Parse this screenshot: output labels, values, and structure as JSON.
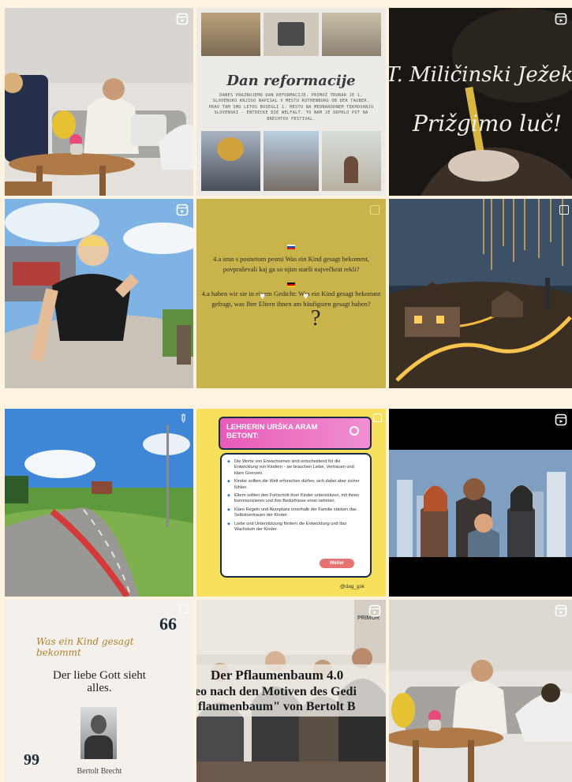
{
  "grid": {
    "posts": [
      {
        "type": "reel",
        "alt": "Two young people sitting on a sofa in a living room"
      },
      {
        "type": "carousel",
        "title": "Dan reformacije",
        "body": "DANES PRAZNUJEMO DAN REFORMACIJE. PRIMOŽ TRUBAR JE 1. SLOVENSKO KNJIGO NAPISAL V MESTU ROTHENBURG OB DER TAUBER. PRAV TAM SMO LETOS BOSEGLI 1. MESTO NA MEDNARODNEM TEKMOVANJU SLOVENSKI - ENTDECKE DIE WELFALT. TO NAM JE ODPRLO POT NA BRECHTOV FESTIVAL."
      },
      {
        "type": "reel",
        "line1": "T. Miličinski Ježek",
        "line2": "Prižgimo luč!"
      },
      {
        "type": "reel",
        "alt": "Young man walking outdoors, fisheye"
      },
      {
        "type": "post",
        "q1": "4.a smo s posnetom pesmi Was ein Kind gesagt bekommt, povpraševali kaj ga so njim starši največkrat rekli?",
        "q2": "4.a haben wir sie in einem Gedicht: Was ein Kind gesagt bekommt gefragt, was Ihre Eltern ihnen am häufigsten gesagt haben?",
        "symbol": "?"
      },
      {
        "type": "carousel",
        "alt": "Glowing village at night"
      },
      {
        "type": "pinned",
        "alt": "Country road with bike lane"
      },
      {
        "type": "carousel",
        "header": "LEHRERIN URŠKA ARAM BETONT:",
        "bullets": [
          "Die Worte von Erwachsenen sind entscheidend für die Entwicklung von Kindern - sie brauchen Liebe, Vertrauen und klare Grenzen.",
          "Kinder sollten die Welt erforschen dürfen, sich dabei aber sicher fühlen.",
          "Eltern sollten den Fortschritt ihrer Kinder unterstützen, mit ihnen kommunizieren und ihre Bedürfnisse ernst nehmen.",
          "Klare Regeln und Akzeptanz innerhalb der Familie stärken das Selbstvertrauen der Kinder.",
          "Liebe und Unterstützung fördern die Entwicklung und das Wachstum der Kinder."
        ],
        "button": "Weiter",
        "handle": "@dag_gsk"
      },
      {
        "type": "reel",
        "alt": "Four young people standing in a city"
      },
      {
        "type": "carousel",
        "script": "Was ein Kind gesagt bekommt",
        "quote": "Der liebe Gott sieht alles.",
        "author": "Bertolt Brecht",
        "open": "66",
        "close": "99"
      },
      {
        "type": "reel",
        "line1": "Der Pflaumenbaum 4.0",
        "line2": "eo nach den Motiven des Gedi",
        "line3": "flaumenbaum\" von Bertolt B",
        "sign": "PRIMGR"
      },
      {
        "type": "reel",
        "alt": "Two young people sitting on a sofa"
      }
    ]
  },
  "colors": {
    "background": "#fdf3e0",
    "mustard": "#c9b34b",
    "pink": "#e85bb8"
  }
}
